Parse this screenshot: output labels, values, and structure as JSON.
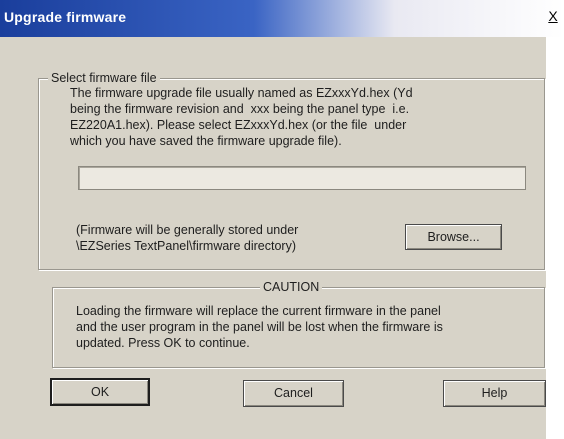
{
  "window": {
    "title": "Upgrade firmware",
    "close_label": "X"
  },
  "select_section": {
    "legend": "Select firmware file",
    "description_lines": [
      "The firmware upgrade file usually named as EZxxxYd.hex (Yd",
      "being the firmware revision and  xxx being the panel type  i.e.",
      "EZ220A1.hex). Please select EZxxxYd.hex (or the file  under",
      "which you have saved the firmware upgrade file)."
    ],
    "file_path_value": "",
    "stored_note_lines": [
      "(Firmware will be generally stored under",
      "\\EZSeries TextPanel\\firmware directory)"
    ],
    "browse_label": "Browse..."
  },
  "caution_section": {
    "legend": "CAUTION",
    "message_lines": [
      "Loading the firmware will replace the current firmware in the panel",
      "and the user program in the panel will be lost when the firmware is",
      "updated. Press OK to continue."
    ]
  },
  "buttons": {
    "ok_label": "OK",
    "cancel_label": "Cancel",
    "help_label": "Help"
  }
}
